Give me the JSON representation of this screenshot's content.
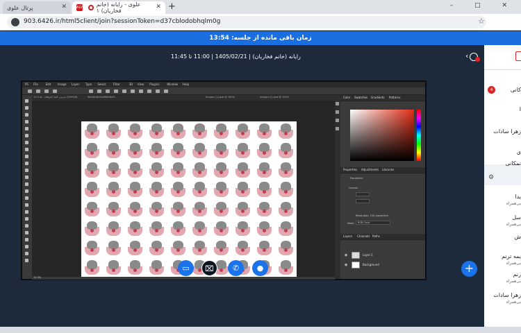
{
  "browser": {
    "tab1_title": "پرتال علوی",
    "tab2_title": "علوی - رایانه (خانم فخاریان) ۱",
    "new_tab": "+",
    "url": "903.6426.ir/html5client/join?sessionToken=d37cblodobhqlm0g",
    "profile_initial": "Y",
    "window_controls": "– □ ✕"
  },
  "meeting": {
    "time_left": "زمان باقی مانده از جلسه: 13:54",
    "title": "رایانه (خانم فخاریان) | 1405/02/21 | 11:00 تا 11:45",
    "control_icons": [
      "screen-share-icon",
      "camera-off-icon",
      "phone-icon",
      "microphone-icon",
      "plus-icon"
    ]
  },
  "photoshop": {
    "menus": [
      "PS",
      "File",
      "Edit",
      "Image",
      "Layer",
      "Type",
      "Select",
      "Filter",
      "3D",
      "View",
      "Plugins",
      "Window",
      "Help"
    ],
    "doc_tabs": [
      "12.5 at ...xIoشرمی کاغذ کادو (CMYK/8)",
      "9bc6b18cfea9f6b9b32...",
      "Images (1).psd @ 100%",
      "Images (1) psd @ 100%"
    ],
    "zoom": "12.5%",
    "right_panels": {
      "color_tabs": [
        "Color",
        "Swatches",
        "Gradients",
        "Patterns"
      ],
      "props_tabs": [
        "Properties",
        "Adjustments",
        "Libraries"
      ],
      "props_label": "Document",
      "canvas_label": "Canvas",
      "resolution": "Resolution: 150 pixels/inch",
      "mode": "Mode",
      "mode_value": "RGB Color",
      "layers_tabs": [
        "Layers",
        "Channels",
        "Paths"
      ],
      "layers": [
        "Layer 1",
        "Background"
      ]
    },
    "pattern_tiles": 80
  },
  "sidebar": {
    "badge": "4",
    "items": [
      {
        "name": "کانی",
        "sub": ""
      },
      {
        "name": "ا",
        "sub": ""
      },
      {
        "name": "زهرا سادات",
        "sub": ""
      },
      {
        "name": "ی",
        "sub": ""
      },
      {
        "name": "نمکانی",
        "sub": ""
      },
      {
        "name": "یدا",
        "sub": "بی‌همراه"
      },
      {
        "name": "سل",
        "sub": "بی‌همراه"
      },
      {
        "name": "ش",
        "sub": ""
      },
      {
        "name": "یمه ترنم",
        "sub": "بی‌همراه"
      },
      {
        "name": "رنم",
        "sub": "بی‌همراه"
      },
      {
        "name": "زهرا سادات",
        "sub": "بی‌همراه"
      }
    ]
  }
}
